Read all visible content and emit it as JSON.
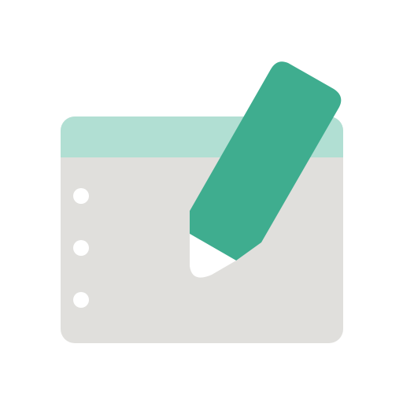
{
  "icon": {
    "name": "notepad-pencil-icon",
    "colors": {
      "background": "#ffffff",
      "notepad_body": "#e0dfdc",
      "notepad_header": "#b1dfd3",
      "binding_holes": "#ffffff",
      "pencil_body": "#3fad8f",
      "pencil_tip": "#ffffff"
    },
    "binding_hole_count": 3
  }
}
